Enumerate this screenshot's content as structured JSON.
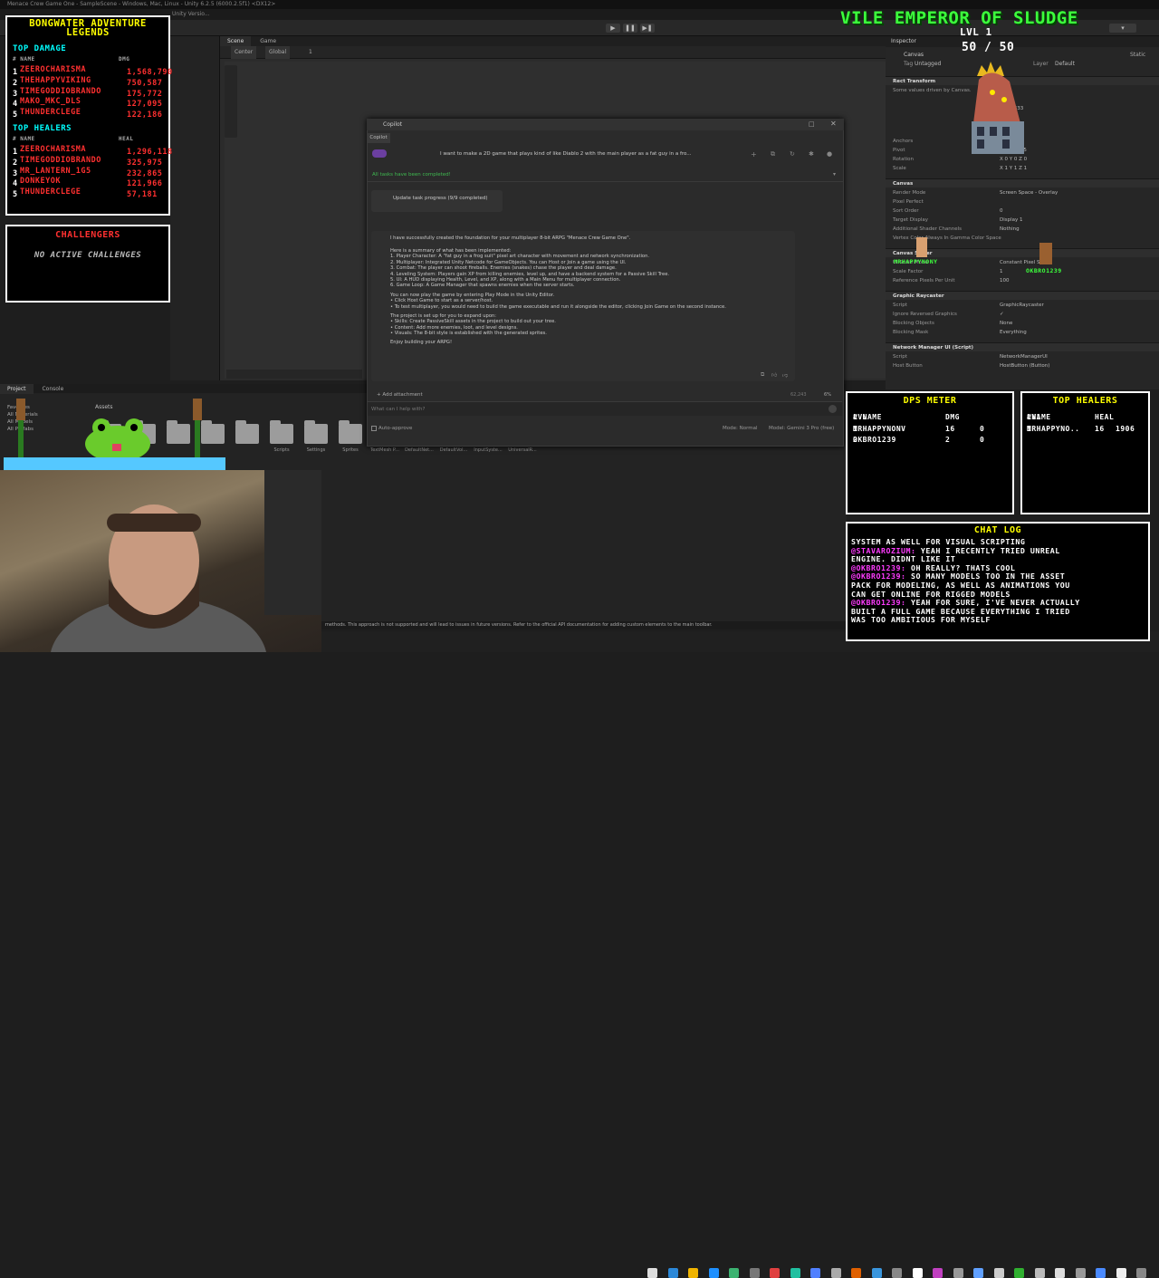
{
  "window": {
    "title": "Menace Crew Game One - SampleScene - Windows, Mac, Linux - Unity 6.2.5 (6000.2.5f1) <DX12>"
  },
  "menu": {
    "items": [
      "Unity Versio..."
    ]
  },
  "scene": {
    "tabs": [
      "Scene",
      "Game"
    ],
    "tools": [
      "Center",
      "Global",
      "1"
    ]
  },
  "inspector": {
    "tab": "Inspector",
    "object_name": "Canvas",
    "static_label": "Static",
    "tag_label": "Tag",
    "tag_value": "Untagged",
    "layer_label": "Layer",
    "layer_value": "Default",
    "sections": [
      {
        "title": "Rect Transform",
        "rows": [
          [
            "Some values driven by Canvas.",
            ""
          ],
          [
            "",
            "Pos X"
          ],
          [
            "",
            "566.6333"
          ],
          [
            "",
            "Height"
          ],
          [
            "",
            "718.6667"
          ]
        ]
      },
      {
        "title": "",
        "rows": [
          [
            "Anchors",
            ""
          ],
          [
            "Pivot",
            "X 0.5   Y 0.5"
          ],
          [
            "Rotation",
            "X 0   Y 0   Z 0"
          ],
          [
            "Scale",
            "X 1   Y 1   Z 1"
          ]
        ]
      },
      {
        "title": "Canvas",
        "rows": [
          [
            "Render Mode",
            "Screen Space - Overlay"
          ],
          [
            "Pixel Perfect",
            ""
          ],
          [
            "Sort Order",
            "0"
          ],
          [
            "Target Display",
            "Display 1"
          ],
          [
            "Additional Shader Channels",
            "Nothing"
          ],
          [
            "Vertex Color Always In Gamma Color Space",
            ""
          ]
        ]
      },
      {
        "title": "Canvas Scaler",
        "rows": [
          [
            "UI Scale Mode",
            "Constant Pixel Size"
          ],
          [
            "Scale Factor",
            "1"
          ],
          [
            "Reference Pixels Per Unit",
            "100"
          ]
        ]
      },
      {
        "title": "Graphic Raycaster",
        "rows": [
          [
            "Script",
            "GraphicRaycaster"
          ],
          [
            "Ignore Reversed Graphics",
            "✓"
          ],
          [
            "Blocking Objects",
            "None"
          ],
          [
            "Blocking Mask",
            "Everything"
          ]
        ]
      },
      {
        "title": "Network Manager UI (Script)",
        "rows": [
          [
            "Script",
            "NetworkManagerUI"
          ],
          [
            "Host Button",
            "HostButton (Button)"
          ]
        ]
      }
    ]
  },
  "project": {
    "tabs": [
      "Project",
      "Console"
    ],
    "breadcrumb": "Assets",
    "tree": [
      "Favorites",
      "All Materials",
      "All Models",
      "All Prefabs"
    ],
    "folders": [
      "",
      "",
      "",
      "",
      "",
      "Scripts",
      "Settings",
      "Sprites",
      "TextMesh P...",
      "DefaultNet...",
      "DefaultVol...",
      "InputSyste...",
      "UniversalR..."
    ]
  },
  "status": {
    "text": "methods. This approach is not supported and will lead to issues in future versions. Refer to the official API documentation for adding custom elements to the main toolbar."
  },
  "copilot": {
    "title": "Copilot",
    "tab": "Copilot",
    "question": "I want to make a 2D game that plays kind of like Diablo 2 with the main player as a fat guy in a fro...",
    "tasks_done": "All tasks have been completed!",
    "task_item": "Update task progress (9/9 completed)",
    "intro": "I have successfully created the foundation for your multiplayer 8-bit ARPG \"Menace Crew Game One\".",
    "summary_head": "Here is a summary of what has been implemented:",
    "features": [
      "1. Player Character: A \"fat guy in a frog suit\" pixel art character with movement and network synchronization.",
      "2. Multiplayer: Integrated Unity Netcode for GameObjects. You can Host or Join a game using the UI.",
      "3. Combat: The player can shoot fireballs. Enemies (snakes) chase the player and deal damage.",
      "4. Leveling System: Players gain XP from killing enemies, level up, and have a backend system for a Passive Skill Tree.",
      "5. UI: A HUD displaying Health, Level, and XP, along with a Main Menu for multiplayer connection.",
      "6. Game Loop: A Game Manager that spawns enemies when the server starts."
    ],
    "play_head": "You can now play the game by entering Play Mode in the Unity Editor.",
    "play_steps": [
      "• Click Host Game to start as a server/host.",
      "• To test multiplayer, you would need to build the game executable and run it alongside the editor, clicking Join Game on the second instance."
    ],
    "expand_head": "The project is set up for you to expand upon:",
    "expand": [
      "• Skills: Create PassiveSkill assets in the project to build out your tree.",
      "• Content: Add more enemies, loot, and level designs.",
      "• Visuals: The 8-bit style is established with the generated sprites."
    ],
    "closing": "Enjoy building your ARPG!",
    "add_attachment": "+ Add attachment",
    "tokens": "62,243",
    "tokens_pct": "6%",
    "input_placeholder": "What can I help with?",
    "auto_approve": "Auto-approve",
    "mode": "Mode: Normal",
    "model": "Model: Gemini 3 Pro (free)"
  },
  "leaderboard": {
    "title_line1": "BONGWATER ADVENTURE",
    "title_line2": "LEGENDS",
    "damage_head": "TOP DAMAGE",
    "heal_head": "TOP HEALERS",
    "col_name": "# NAME",
    "col_dmg": "DMG",
    "col_heal": "HEAL",
    "damage": [
      {
        "rank": "1",
        "name": "ZEEROCHARISMA",
        "value": "1,568,790"
      },
      {
        "rank": "2",
        "name": "THEHAPPYVIKING",
        "value": "750,587"
      },
      {
        "rank": "3",
        "name": "TIMEGODDIOBRANDO",
        "value": "175,772"
      },
      {
        "rank": "4",
        "name": "MAKO_MKC_DLS",
        "value": "127,095"
      },
      {
        "rank": "5",
        "name": "THUNDERCLEGE",
        "value": "122,186"
      }
    ],
    "healers": [
      {
        "rank": "1",
        "name": "ZEEROCHARISMA",
        "value": "1,296,118"
      },
      {
        "rank": "2",
        "name": "TIMEGODDIOBRANDO",
        "value": "325,975"
      },
      {
        "rank": "3",
        "name": "MR_LANTERN_1G5",
        "value": "232,865"
      },
      {
        "rank": "4",
        "name": "DONKEYOK",
        "value": "121,966"
      },
      {
        "rank": "5",
        "name": "THUNDERCLEGE",
        "value": "57,181"
      }
    ]
  },
  "challengers": {
    "title": "CHALLENGERS",
    "status": "NO ACTIVE CHALLENGES"
  },
  "boss": {
    "name": "VILE EMPEROR OF SLUDGE",
    "level": "LVL 1",
    "hp": "50 / 50"
  },
  "players": {
    "p1": "MRHAPPYNONY",
    "p2": "OKBRO1239"
  },
  "dps_meter": {
    "title": "DPS METER",
    "headers": [
      "# NAME",
      "LVL",
      "DMG"
    ],
    "rows": [
      [
        "1",
        "MRHAPPYNONV",
        "16",
        "0"
      ],
      [
        "2",
        "OKBRO1239",
        "2",
        "0"
      ]
    ]
  },
  "top_healers_meter": {
    "title": "TOP HEALERS",
    "headers": [
      "#NAME",
      "LVL",
      "HEAL"
    ],
    "rows": [
      [
        "1",
        "MRHAPPYNO..",
        "16",
        "1906"
      ]
    ]
  },
  "chat": {
    "title": "CHAT LOG",
    "lines": [
      {
        "user": "",
        "text": "SYSTEM AS WELL FOR VISUAL SCRIPTING"
      },
      {
        "user": "@STAVAROZIUM:",
        "text": " YEAH I RECENTLY TRIED UNREAL"
      },
      {
        "user": "",
        "text": "ENGINE. DIDNT LIKE IT"
      },
      {
        "user": "@OKBRO1239:",
        "text": " OH REALLY? THATS COOL"
      },
      {
        "user": "@OKBRO1239:",
        "text": " SO MANY MODELS TOO IN THE ASSET"
      },
      {
        "user": "",
        "text": "PACK FOR MODELING, AS WELL AS ANIMATIONS YOU"
      },
      {
        "user": "",
        "text": "CAN GET ONLINE FOR RIGGED MODELS"
      },
      {
        "user": "@OKBRO1239:",
        "text": " YEAH FOR SURE, I'VE NEVER ACTUALLY"
      },
      {
        "user": "",
        "text": "BUILT A FULL GAME BECAUSE EVERYTHING I TRIED"
      },
      {
        "user": "",
        "text": "WAS TOO AMBITIOUS FOR MYSELF"
      }
    ]
  },
  "colors": {
    "accent_green": "#3fb950",
    "pixel_yellow": "#ffff00",
    "pixel_cyan": "#00ffff",
    "pixel_red": "#ff3030",
    "boss_green": "#3cff3c"
  }
}
